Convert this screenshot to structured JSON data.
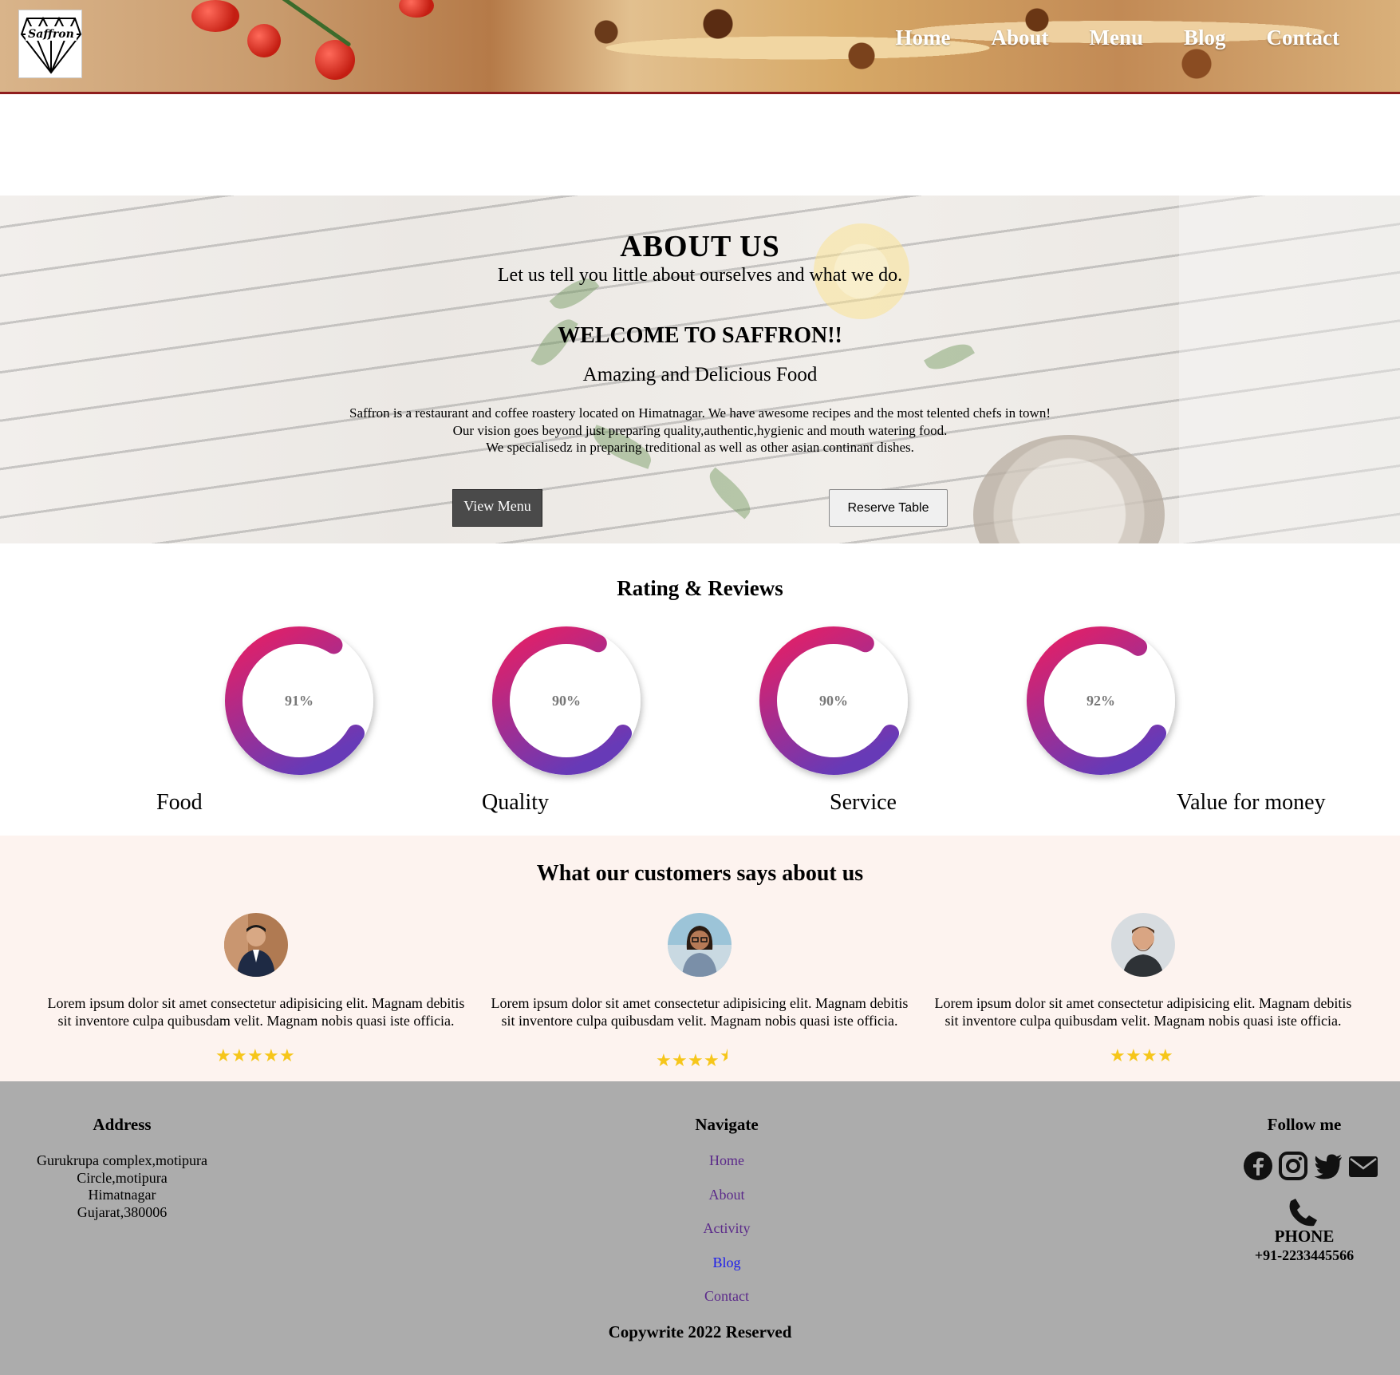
{
  "brand": {
    "logo_text": "Saffron"
  },
  "nav": {
    "items": [
      {
        "label": "Home"
      },
      {
        "label": "About"
      },
      {
        "label": "Menu"
      },
      {
        "label": "Blog"
      },
      {
        "label": "Contact"
      }
    ]
  },
  "about": {
    "title": "ABOUT US",
    "subtitle": "Let us tell you little about ourselves and what we do.",
    "welcome": "WELCOME TO SAFFRON!!",
    "tagline": "Amazing and Delicious Food",
    "desc_lines": [
      "Saffron is a restaurant and coffee roastery located on Himatnagar. We have awesome recipes and the most telented chefs in town!",
      "Our vision goes beyond just preparing quality,authentic,hygienic and mouth watering food.",
      "We specialisedz in preparing treditional as well as other asian continant dishes."
    ],
    "view_menu_label": "View Menu",
    "reserve_label": "Reserve Table"
  },
  "ratings": {
    "title": "Rating & Reviews",
    "gradient": [
      "#e91e63",
      "#673ab7"
    ],
    "items": [
      {
        "label": "Food",
        "percent": 91,
        "percent_text": "91%"
      },
      {
        "label": "Quality",
        "percent": 90,
        "percent_text": "90%"
      },
      {
        "label": "Service",
        "percent": 90,
        "percent_text": "90%"
      },
      {
        "label": "Value for money",
        "percent": 92,
        "percent_text": "92%"
      }
    ]
  },
  "testimonials": {
    "title": "What our customers says about us",
    "star_color": "#f6c61a",
    "items": [
      {
        "text": "Lorem ipsum dolor sit amet consectetur adipisicing elit. Magnam debitis sit inventore culpa quibusdam velit. Magnam nobis quasi iste officia.",
        "stars": 5
      },
      {
        "text": "Lorem ipsum dolor sit amet consectetur adipisicing elit. Magnam debitis sit inventore culpa quibusdam velit. Magnam nobis quasi iste officia.",
        "stars": 4.5
      },
      {
        "text": "Lorem ipsum dolor sit amet consectetur adipisicing elit. Magnam debitis sit inventore culpa quibusdam velit. Magnam nobis quasi iste officia.",
        "stars": 4
      }
    ]
  },
  "footer": {
    "address_title": "Address",
    "address_lines": [
      "Gurukrupa complex,motipura",
      "Circle,motipura",
      "Himatnagar",
      "Gujarat,380006"
    ],
    "navigate_title": "Navigate",
    "navigate_links": [
      "Home",
      "About",
      "Activity",
      "Blog",
      "Contact"
    ],
    "follow_title": "Follow me",
    "social_icons": [
      "facebook-icon",
      "instagram-icon",
      "twitter-icon",
      "email-icon"
    ],
    "phone_label": "PHONE",
    "phone_number": "+91-2233445566",
    "copyright": "Copywrite 2022 Reserved"
  }
}
